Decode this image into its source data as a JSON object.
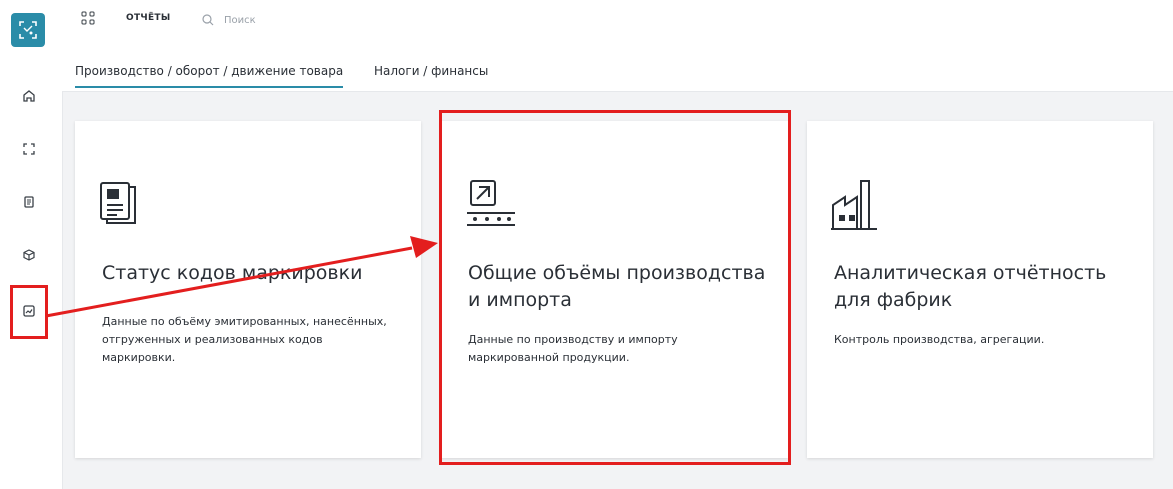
{
  "topbar": {
    "app_name": "ОТЧЁТЫ",
    "search_placeholder": "Поиск"
  },
  "tabs": [
    {
      "label": "Производство / оборот / движение товара",
      "active": true
    },
    {
      "label": "Налоги / финансы",
      "active": false
    }
  ],
  "sidebar": {
    "items": [
      "home-icon",
      "scan-icon",
      "document-icon",
      "box-icon",
      "reports-icon"
    ],
    "active": "reports-icon"
  },
  "cards": [
    {
      "title": "Статус кодов маркировки",
      "description": "Данные по объёму эмитированных, нанесённых, отгруженных и реализованных кодов маркировки.",
      "icon": "document-code-icon"
    },
    {
      "title": "Общие объёмы производства и импорта",
      "description": "Данные по производству и импорту маркированной продукции.",
      "icon": "conveyor-icon"
    },
    {
      "title": "Аналитическая отчётность для фабрик",
      "description": "Контроль производства, агрегации.",
      "icon": "factory-icon"
    }
  ],
  "colors": {
    "accent": "#2a8ca8",
    "annotation": "#e31e1e"
  }
}
